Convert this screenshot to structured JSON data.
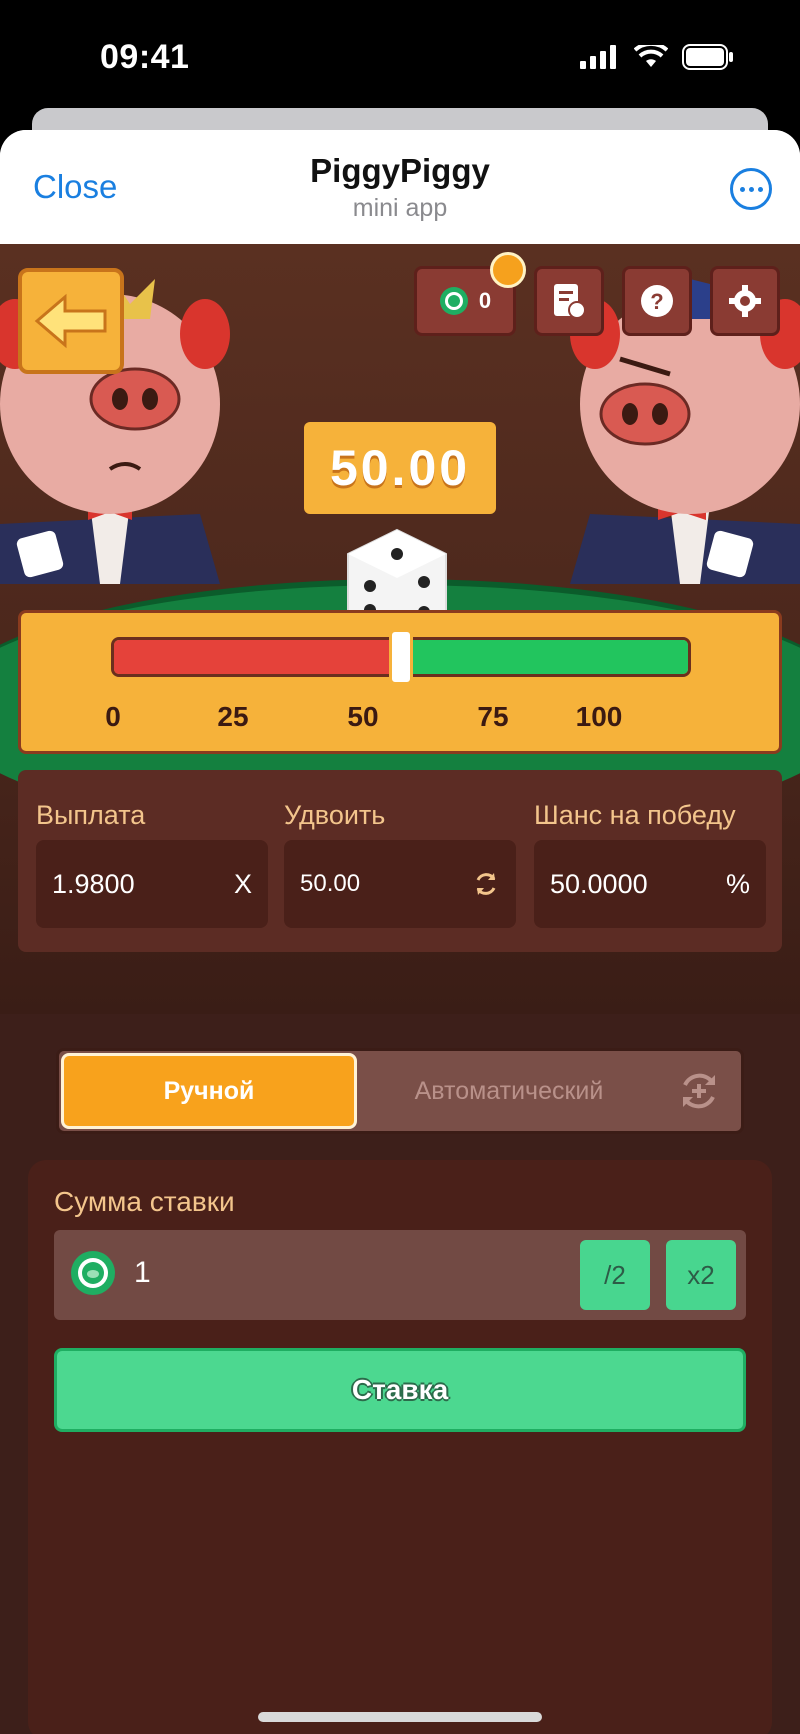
{
  "status_bar": {
    "time": "09:41"
  },
  "header": {
    "close_label": "Close",
    "title": "PiggyPiggy",
    "subtitle": "mini app"
  },
  "top_bar": {
    "balance": "0"
  },
  "game": {
    "result": "50.00",
    "slider": {
      "value": 50,
      "min": 0,
      "max": 100,
      "ticks": [
        "0",
        "25",
        "50",
        "75",
        "100"
      ]
    }
  },
  "params": {
    "payout": {
      "label": "Выплата",
      "value": "1.9800",
      "suffix": "X"
    },
    "double": {
      "label": "Удвоить",
      "value": "50.00"
    },
    "chance": {
      "label": "Шанс на победу",
      "value": "50.0000",
      "suffix": "%"
    }
  },
  "mode": {
    "manual_label": "Ручной",
    "auto_label": "Автоматический",
    "active": "manual"
  },
  "bet": {
    "label": "Сумма ставки",
    "amount": "1",
    "half_label": "/2",
    "double_label": "x2",
    "submit_label": "Ставка"
  },
  "colors": {
    "accent": "#f6b23a",
    "green": "#4cd890",
    "red": "#e5423a",
    "link": "#1a7fe0"
  },
  "icons": [
    "back-arrow-icon",
    "chip-icon",
    "history-icon",
    "help-icon",
    "gear-icon",
    "dice-icon",
    "auto-refresh-icon",
    "refresh-icon",
    "more-icon"
  ]
}
